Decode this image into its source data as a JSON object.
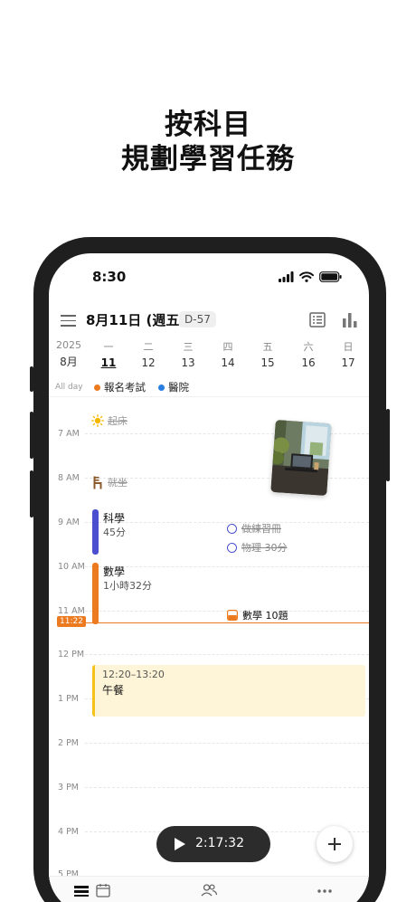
{
  "promo": {
    "line1": "按科目",
    "line2": "規劃學習任務"
  },
  "status": {
    "time": "8:30"
  },
  "header": {
    "date": "8月11日 (週五)",
    "dday": "D-57"
  },
  "week": {
    "year": "2025",
    "month": "8月",
    "days": [
      {
        "weekday": "一",
        "date": "11",
        "selected": true
      },
      {
        "weekday": "二",
        "date": "12"
      },
      {
        "weekday": "三",
        "date": "13"
      },
      {
        "weekday": "四",
        "date": "14"
      },
      {
        "weekday": "五",
        "date": "15"
      },
      {
        "weekday": "六",
        "date": "16"
      },
      {
        "weekday": "日",
        "date": "17"
      }
    ]
  },
  "allday": {
    "label": "All day",
    "events": [
      {
        "name": "報名考試",
        "color": "#ec7a1f"
      },
      {
        "name": "醫院",
        "color": "#2a7de1"
      }
    ]
  },
  "hours": [
    "7 AM",
    "8 AM",
    "9 AM",
    "10 AM",
    "11 AM",
    "12 PM",
    "1 PM",
    "2 PM",
    "3 PM",
    "4 PM",
    "5 PM"
  ],
  "routines": [
    {
      "label": "起床",
      "icon": "sun-icon"
    },
    {
      "label": "就坐",
      "icon": "chair-icon"
    }
  ],
  "subjects": [
    {
      "name": "科學",
      "duration": "45分",
      "color": "#4b4fcf"
    },
    {
      "name": "數學",
      "duration": "1小時32分",
      "color": "#ec7a1f"
    }
  ],
  "tasks": [
    {
      "label": "做練習冊",
      "done": true
    },
    {
      "label": "物理 30分",
      "done": true
    },
    {
      "label": "數學 10題",
      "done": false
    }
  ],
  "now": {
    "time": "11:22"
  },
  "events": [
    {
      "time": "12:20–13:20",
      "name": "午餐",
      "color": "#f5c21a"
    }
  ],
  "timer": {
    "value": "2:17:32"
  },
  "colors": {
    "accent": "#ec7a1f",
    "science": "#4b4fcf",
    "lunch_bg": "#fef4d7"
  }
}
